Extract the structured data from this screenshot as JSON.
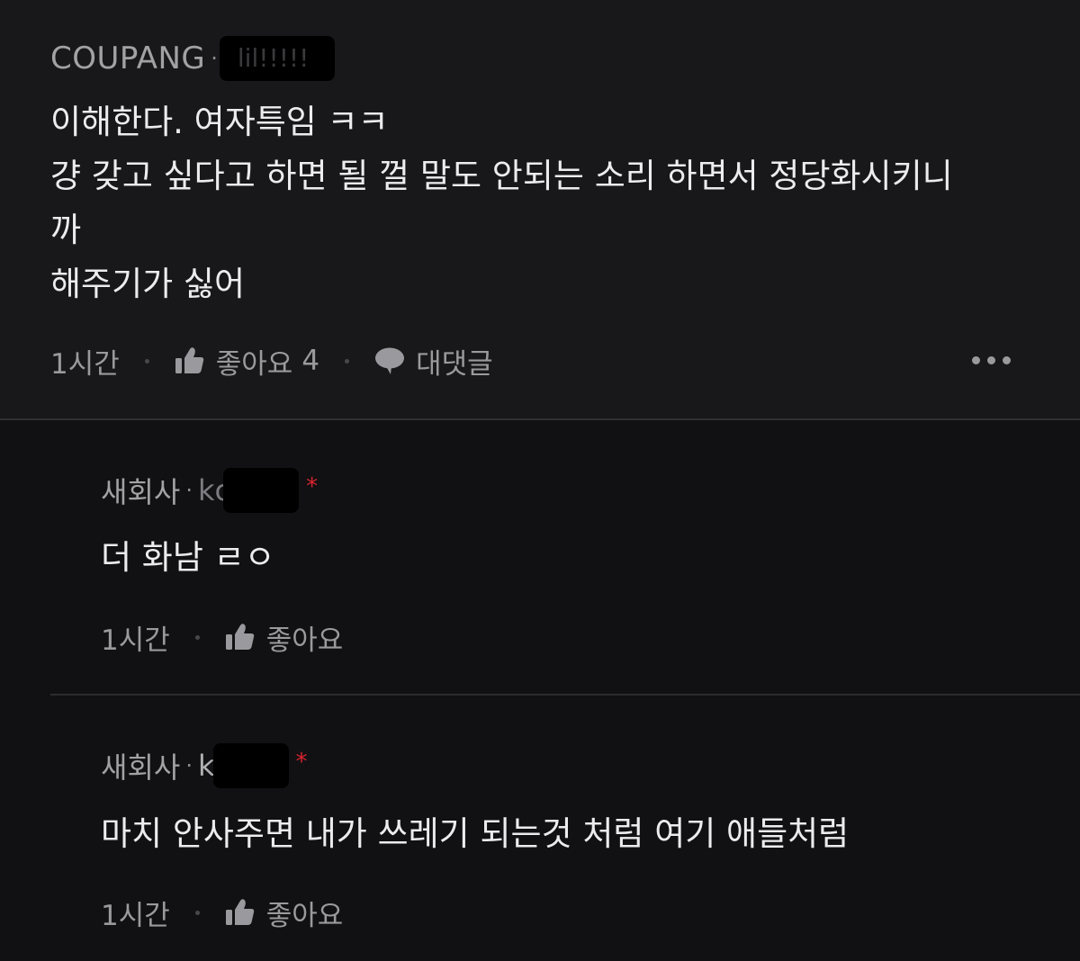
{
  "main_comment": {
    "company": "COUPANG",
    "nickname": "lil!!!!!",
    "body_lines": [
      "이해한다. 여자특임 ㅋㅋ",
      "걍 갖고 싶다고 하면 될 껄 말도 안되는 소리 하면서 정당화시키니",
      "까",
      "해주기가 싫어"
    ],
    "time": "1시간",
    "like_label": "좋아요",
    "like_count": "4",
    "reply_label": "대댓글"
  },
  "replies": [
    {
      "company": "새회사",
      "nickname_visible": "kc",
      "author_mark": "*",
      "body": "더 화남 ㄹㅇ",
      "time": "1시간",
      "like_label": "좋아요"
    },
    {
      "company": "새회사",
      "nickname_visible": "k",
      "author_mark": "*",
      "body": "마치 안사주면 내가 쓰레기 되는것 처럼 여기 애들처럼",
      "time": "1시간",
      "like_label": "좋아요"
    }
  ],
  "icons": {
    "like": "thumbs-up-icon",
    "reply": "speech-bubble-icon",
    "more": "more-dots-icon"
  },
  "colors": {
    "background": "#111113",
    "main_comment_bg": "#18181a",
    "author_star": "#d8232f"
  }
}
